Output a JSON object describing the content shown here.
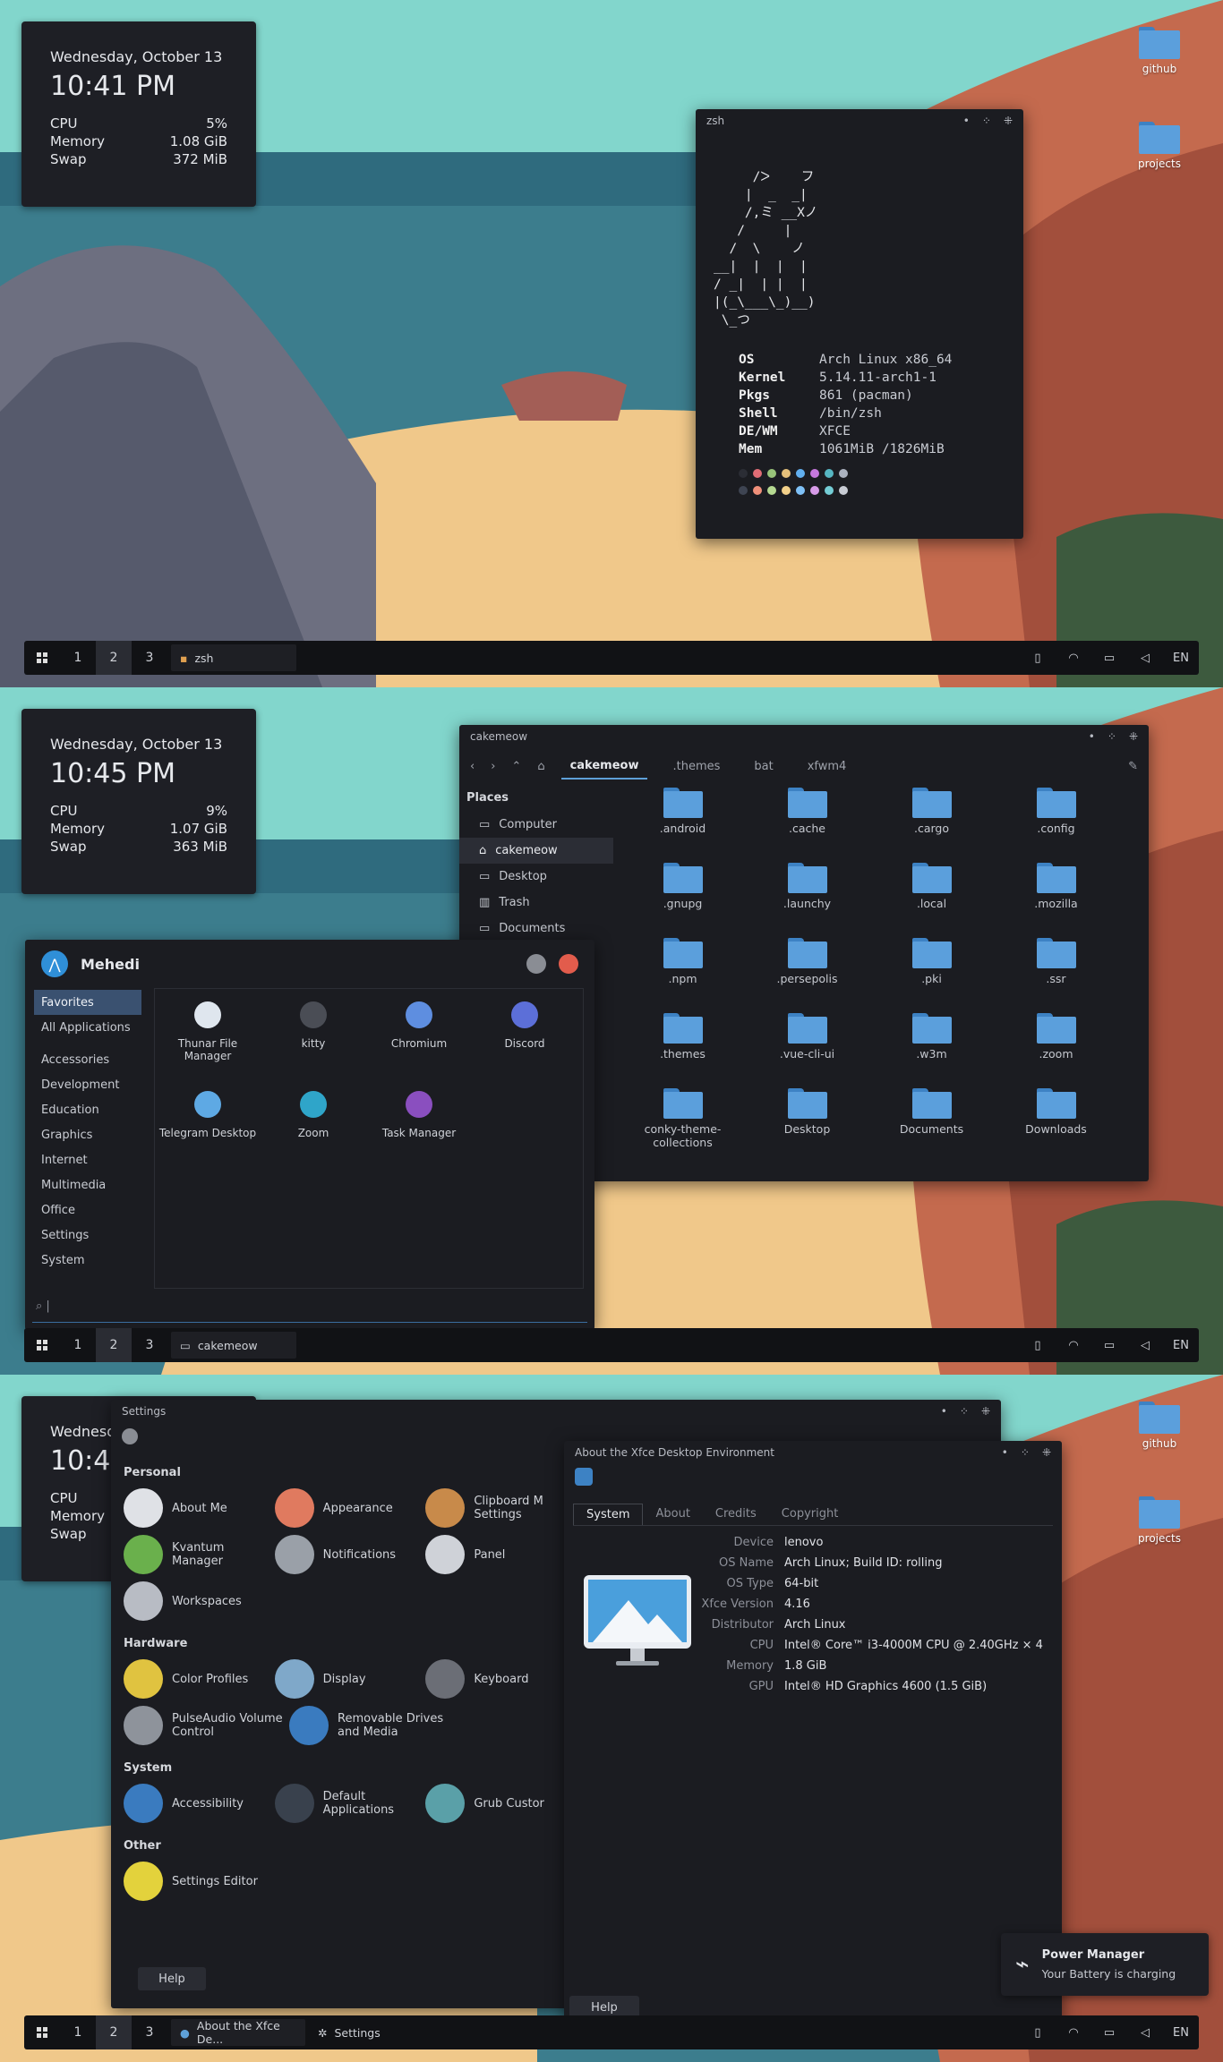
{
  "desktop_icons": [
    "github",
    "projects"
  ],
  "panel": {
    "workspaces": [
      "1",
      "2",
      "3"
    ],
    "lang": "EN"
  },
  "shot1": {
    "clock": {
      "date": "Wednesday, October 13",
      "time": "10:41 PM",
      "stats": [
        [
          "CPU",
          "5%"
        ],
        [
          "Memory",
          "1.08 GiB"
        ],
        [
          "Swap",
          "372 MiB"
        ]
      ]
    },
    "terminal": {
      "title": "zsh",
      "art": "     /ᐳ    フ\n    |  _  _|\n    /,ミ __Xノ\n   /     |\n  /  \\    ノ\n__|  |  |  |\n/ _|  | |  |\n|(_\\___\\_)__)\n \\_つ",
      "info": [
        [
          "OS",
          "Arch Linux x86_64"
        ],
        [
          "Kernel",
          "5.14.11-arch1-1"
        ],
        [
          "Pkgs",
          "861 (pacman)"
        ],
        [
          "Shell",
          "/bin/zsh"
        ],
        [
          "DE/WM",
          "XFCE"
        ],
        [
          "Mem",
          "1061MiB /1826MiB"
        ]
      ],
      "colors_row1": [
        "#2b2d35",
        "#e06c75",
        "#98c379",
        "#e5c07b",
        "#61afef",
        "#c678dd",
        "#56b6c2",
        "#abb2bf"
      ],
      "colors_row2": [
        "#3e4452",
        "#f0907a",
        "#b5d991",
        "#f2d08a",
        "#7fc1f7",
        "#d79be8",
        "#74cdd6",
        "#c8ccd4"
      ]
    },
    "task": "zsh"
  },
  "shot2": {
    "clock": {
      "date": "Wednesday, October 13",
      "time": "10:45 PM",
      "stats": [
        [
          "CPU",
          "9%"
        ],
        [
          "Memory",
          "1.07 GiB"
        ],
        [
          "Swap",
          "363 MiB"
        ]
      ]
    },
    "filemanager": {
      "title": "cakemeow",
      "breadcrumbs": [
        "cakemeow",
        ".themes",
        "bat",
        "xfwm4"
      ],
      "places_title": "Places",
      "places": [
        "Computer",
        "cakemeow",
        "Desktop",
        "Trash",
        "Documents"
      ],
      "files": [
        ".android",
        ".cache",
        ".cargo",
        ".config",
        ".gnupg",
        ".launchy",
        ".local",
        ".mozilla",
        ".npm",
        ".persepolis",
        ".pki",
        ".ssr",
        ".themes",
        ".vue-cli-ui",
        ".w3m",
        ".zoom",
        "conky-theme-collections",
        "Desktop",
        "Documents",
        "Downloads"
      ]
    },
    "whisker": {
      "user": "Mehedi",
      "categories": [
        "Favorites",
        "All Applications",
        "Accessories",
        "Development",
        "Education",
        "Graphics",
        "Internet",
        "Multimedia",
        "Office",
        "Settings",
        "System"
      ],
      "apps": [
        {
          "label": "Thunar File Manager",
          "color": "#dfe6ee"
        },
        {
          "label": "kitty",
          "color": "#4a4d55"
        },
        {
          "label": "Chromium",
          "color": "#5e8ee0"
        },
        {
          "label": "Discord",
          "color": "#5c6fd8"
        },
        {
          "label": "Telegram Desktop",
          "color": "#5ea9e4"
        },
        {
          "label": "Zoom",
          "color": "#2fa5c9"
        },
        {
          "label": "Task Manager",
          "color": "#8a4fbf"
        }
      ]
    },
    "task": "cakemeow"
  },
  "shot3": {
    "clock": {
      "date": "Wednesday, October 13",
      "time": "10:46",
      "stats": [
        [
          "CPU",
          ""
        ],
        [
          "Memory",
          ""
        ],
        [
          "Swap",
          ""
        ]
      ]
    },
    "settings": {
      "title": "Settings",
      "sections": [
        {
          "name": "Personal",
          "rows": [
            [
              {
                "label": "About Me",
                "color": "#dfe1e6"
              },
              {
                "label": "Appearance",
                "color": "#e07a5f"
              },
              {
                "label": "Clipboard M Settings",
                "color": "#c88a4a"
              }
            ],
            [
              {
                "label": "Kvantum Manager",
                "color": "#6ab04c"
              },
              {
                "label": "Notifications",
                "color": "#9aa0a8"
              },
              {
                "label": "Panel",
                "color": "#cfd2d8"
              }
            ],
            [
              {
                "label": "Workspaces",
                "color": "#b8bcc4"
              }
            ]
          ]
        },
        {
          "name": "Hardware",
          "rows": [
            [
              {
                "label": "Color Profiles",
                "color": "#e0c340"
              },
              {
                "label": "Display",
                "color": "#7fa8c9"
              },
              {
                "label": "Keyboard",
                "color": "#6b6e76"
              }
            ],
            [
              {
                "label": "PulseAudio Volume Control",
                "color": "#8e939b"
              },
              {
                "label": "Removable Drives and Media",
                "color": "#3a7bbf"
              }
            ]
          ]
        },
        {
          "name": "System",
          "rows": [
            [
              {
                "label": "Accessibility",
                "color": "#3a7bbf"
              },
              {
                "label": "Default Applications",
                "color": "#39414d"
              },
              {
                "label": "Grub Custor",
                "color": "#5aa0a8"
              }
            ]
          ]
        },
        {
          "name": "Other",
          "rows": [
            [
              {
                "label": "Settings Editor",
                "color": "#e3d23c"
              }
            ]
          ]
        }
      ],
      "help": "Help"
    },
    "about": {
      "title": "About the Xfce Desktop Environment",
      "tabs": [
        "System",
        "About",
        "Credits",
        "Copyright"
      ],
      "fields": [
        [
          "Device",
          "lenovo"
        ],
        [
          "OS Name",
          "Arch Linux; Build ID: rolling"
        ],
        [
          "OS Type",
          "64-bit"
        ],
        [
          "Xfce Version",
          "4.16"
        ],
        [
          "Distributor",
          "Arch Linux"
        ],
        [
          "CPU",
          "Intel® Core™ i3-4000M CPU @ 2.40GHz × 4"
        ],
        [
          "Memory",
          "1.8 GiB"
        ],
        [
          "GPU",
          "Intel® HD Graphics 4600 (1.5 GiB)"
        ]
      ],
      "help": "Help"
    },
    "notification": {
      "title": "Power Manager",
      "body": "Your Battery is charging"
    },
    "tasks": [
      "About the Xfce De...",
      "Settings"
    ]
  }
}
